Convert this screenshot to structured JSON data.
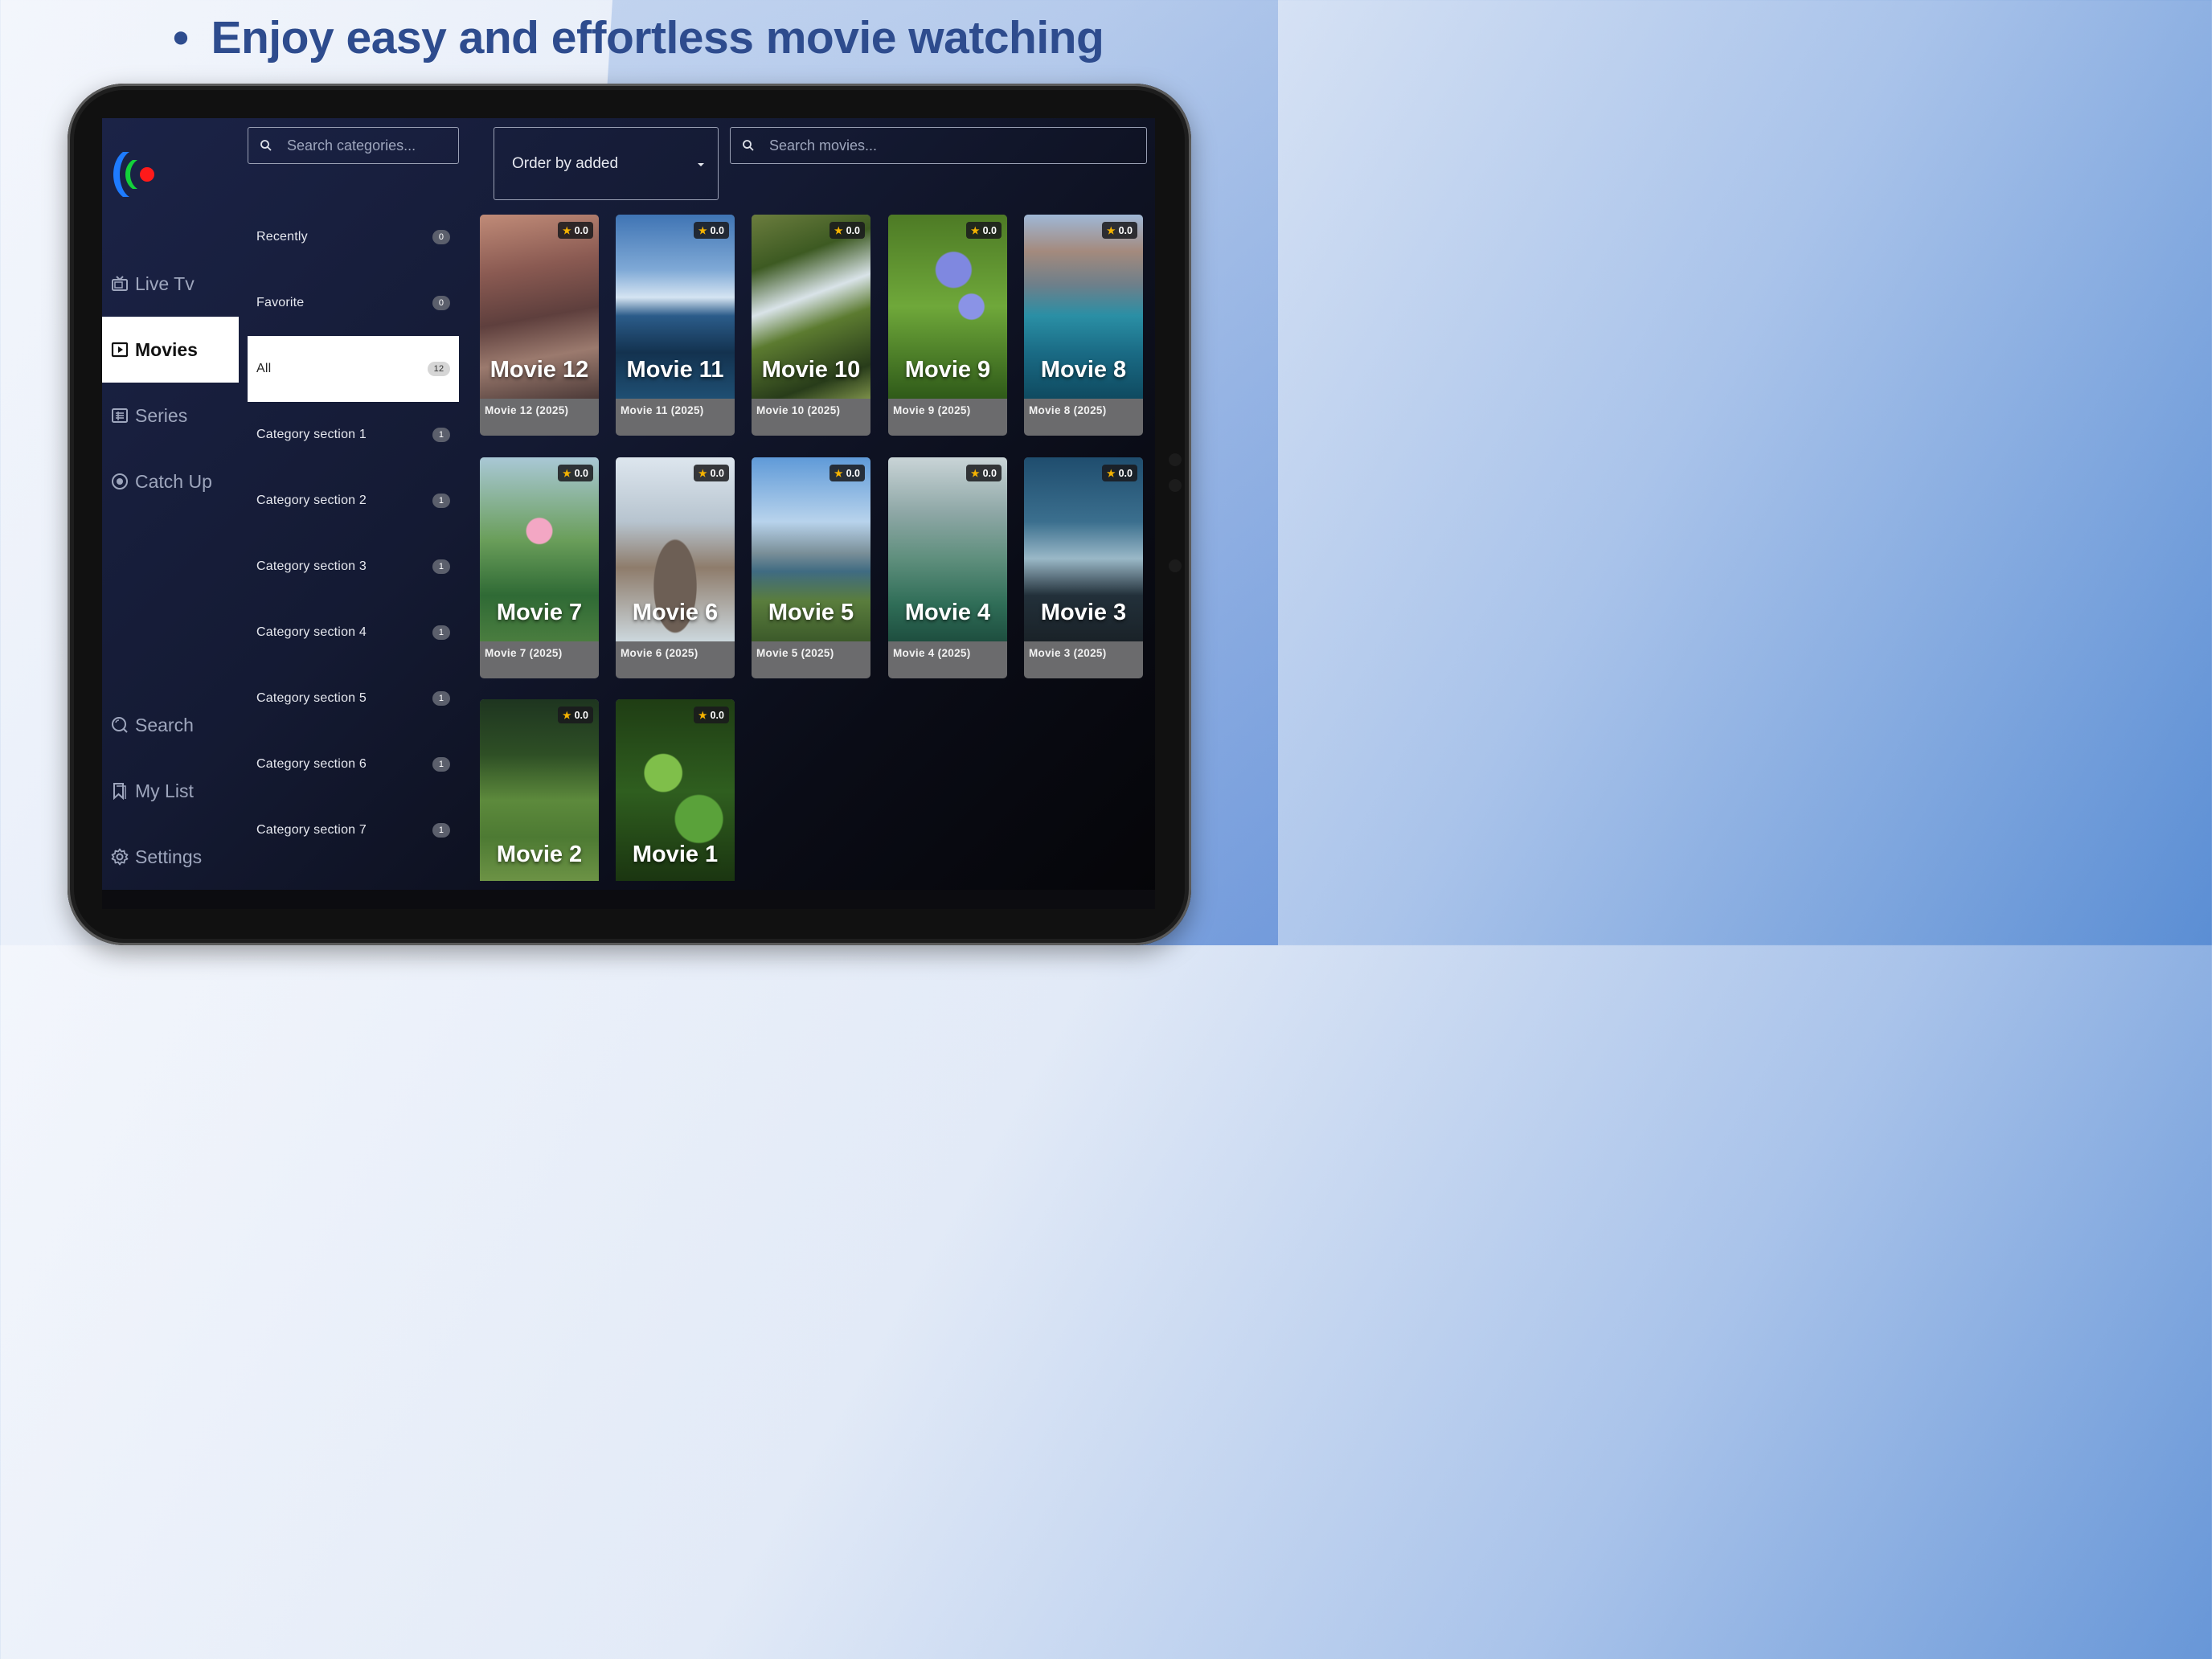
{
  "headline": {
    "bullet": "•",
    "text": "Enjoy easy and effortless movie watching"
  },
  "nav": {
    "items": [
      {
        "label": "Live Tv",
        "icon": "tv-icon",
        "active": false
      },
      {
        "label": "Movies",
        "icon": "movie-icon",
        "active": true
      },
      {
        "label": "Series",
        "icon": "series-icon",
        "active": false
      },
      {
        "label": "Catch Up",
        "icon": "catchup-icon",
        "active": false
      },
      {
        "label": "Search",
        "icon": "search-icon",
        "active": false
      },
      {
        "label": "My List",
        "icon": "bookmark-icon",
        "active": false
      },
      {
        "label": "Settings",
        "icon": "gear-icon",
        "active": false
      }
    ]
  },
  "categories": {
    "search_placeholder": "Search categories...",
    "items": [
      {
        "label": "Recently",
        "count": "0",
        "active": false
      },
      {
        "label": "Favorite",
        "count": "0",
        "active": false
      },
      {
        "label": "All",
        "count": "12",
        "active": true
      },
      {
        "label": "Category section 1",
        "count": "1",
        "active": false
      },
      {
        "label": "Category section 2",
        "count": "1",
        "active": false
      },
      {
        "label": "Category section 3",
        "count": "1",
        "active": false
      },
      {
        "label": "Category section 4",
        "count": "1",
        "active": false
      },
      {
        "label": "Category section 5",
        "count": "1",
        "active": false
      },
      {
        "label": "Category section 6",
        "count": "1",
        "active": false
      },
      {
        "label": "Category section 7",
        "count": "1",
        "active": false
      }
    ]
  },
  "toolbar": {
    "order_label": "Order by added",
    "movie_search_placeholder": "Search movies..."
  },
  "movies": [
    {
      "poster_title": "Movie 12",
      "caption": "Movie 12 (2025)",
      "rating": "0.0"
    },
    {
      "poster_title": "Movie 11",
      "caption": "Movie 11 (2025)",
      "rating": "0.0"
    },
    {
      "poster_title": "Movie 10",
      "caption": "Movie 10 (2025)",
      "rating": "0.0"
    },
    {
      "poster_title": "Movie 9",
      "caption": "Movie 9 (2025)",
      "rating": "0.0"
    },
    {
      "poster_title": "Movie 8",
      "caption": "Movie 8 (2025)",
      "rating": "0.0"
    },
    {
      "poster_title": "Movie 7",
      "caption": "Movie 7 (2025)",
      "rating": "0.0"
    },
    {
      "poster_title": "Movie 6",
      "caption": "Movie 6 (2025)",
      "rating": "0.0"
    },
    {
      "poster_title": "Movie 5",
      "caption": "Movie 5 (2025)",
      "rating": "0.0"
    },
    {
      "poster_title": "Movie 4",
      "caption": "Movie 4 (2025)",
      "rating": "0.0"
    },
    {
      "poster_title": "Movie 3",
      "caption": "Movie 3 (2025)",
      "rating": "0.0"
    },
    {
      "poster_title": "Movie 2",
      "caption": "",
      "rating": "0.0"
    },
    {
      "poster_title": "Movie 1",
      "caption": "",
      "rating": "0.0"
    }
  ],
  "colors": {
    "accent_blue": "#2e4c8e",
    "active_nav_bg": "#ffffff",
    "rating_star": "#f5b301"
  }
}
